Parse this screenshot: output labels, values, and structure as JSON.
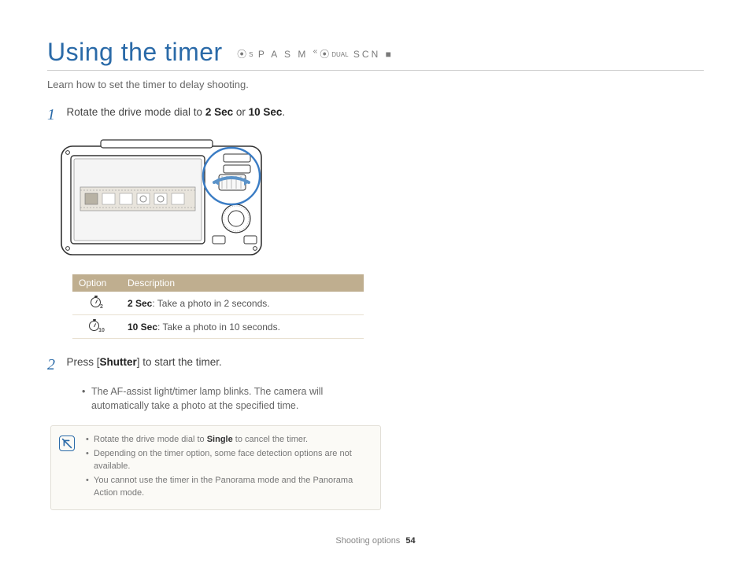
{
  "title": "Using the timer",
  "mode_chips": {
    "cam_s": "S",
    "modes": "P A S M",
    "dual": "DUAL",
    "scn": "SCN"
  },
  "intro": "Learn how to set the timer to delay shooting.",
  "steps": [
    {
      "num": "1",
      "text_pre": "Rotate the drive mode dial to ",
      "text_b1": "2 Sec",
      "text_mid": " or ",
      "text_b2": "10 Sec",
      "text_post": "."
    },
    {
      "num": "2",
      "text_pre": "Press [",
      "text_b1": "Shutter",
      "text_mid": "",
      "text_b2": "",
      "text_post": "] to start the timer."
    }
  ],
  "table": {
    "headers": {
      "option": "Option",
      "description": "Description"
    },
    "rows": [
      {
        "sub": "2",
        "label": "2 Sec",
        "desc": ": Take a photo in 2 seconds."
      },
      {
        "sub": "10",
        "label": "10 Sec",
        "desc": ": Take a photo in 10 seconds."
      }
    ]
  },
  "sub_bullets": [
    "The AF-assist light/timer lamp blinks. The camera will automatically take a photo at the specified time."
  ],
  "notes": {
    "items": [
      {
        "pre": "Rotate the drive mode dial to ",
        "b": "Single",
        "post": " to cancel the timer."
      },
      {
        "pre": "Depending on the timer option, some face detection options are not available.",
        "b": "",
        "post": ""
      },
      {
        "pre": "You cannot use the timer in the Panorama mode and the Panorama Action mode.",
        "b": "",
        "post": ""
      }
    ]
  },
  "footer": {
    "section": "Shooting options",
    "page": "54"
  }
}
